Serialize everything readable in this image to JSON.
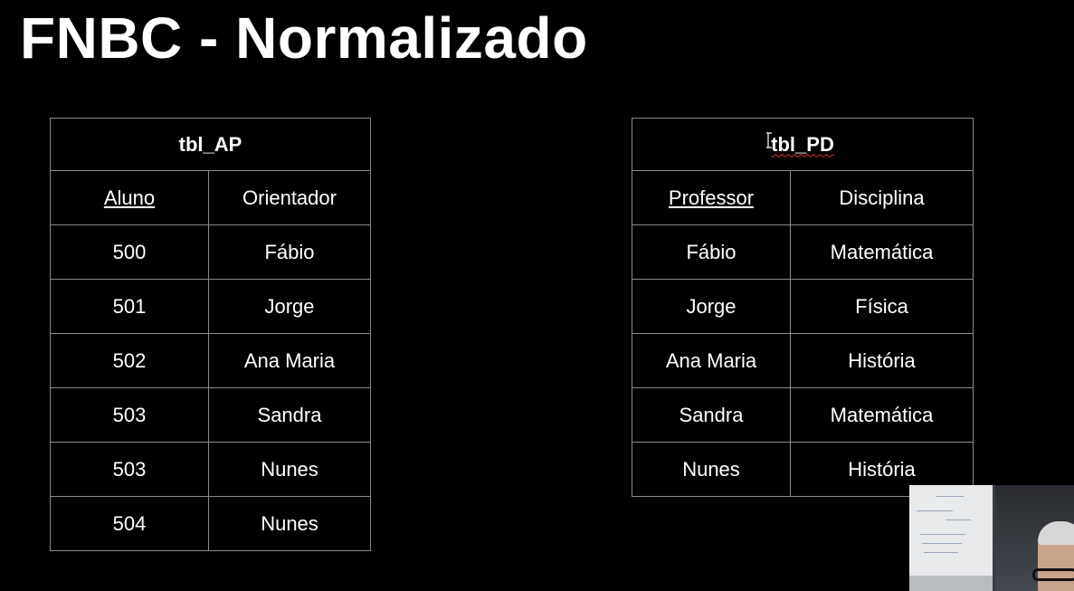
{
  "title": "FNBC - Normalizado",
  "tables": {
    "ap": {
      "name": "tbl_AP",
      "headers": [
        "Aluno",
        "Orientador"
      ],
      "rows": [
        [
          "500",
          "Fábio"
        ],
        [
          "501",
          "Jorge"
        ],
        [
          "502",
          "Ana Maria"
        ],
        [
          "503",
          "Sandra"
        ],
        [
          "503",
          "Nunes"
        ],
        [
          "504",
          "Nunes"
        ]
      ]
    },
    "pd": {
      "name": "tbl_PD",
      "headers": [
        "Professor",
        "Disciplina"
      ],
      "rows": [
        [
          "Fábio",
          "Matemática"
        ],
        [
          "Jorge",
          "Física"
        ],
        [
          "Ana Maria",
          "História"
        ],
        [
          "Sandra",
          "Matemática"
        ],
        [
          "Nunes",
          "História"
        ]
      ]
    }
  },
  "colors": {
    "background": "#000000",
    "text": "#ffffff",
    "border": "#8a8a8a",
    "spellcheck": "#dd3333"
  },
  "icons": {
    "text_cursor": "i-beam-cursor-icon"
  }
}
